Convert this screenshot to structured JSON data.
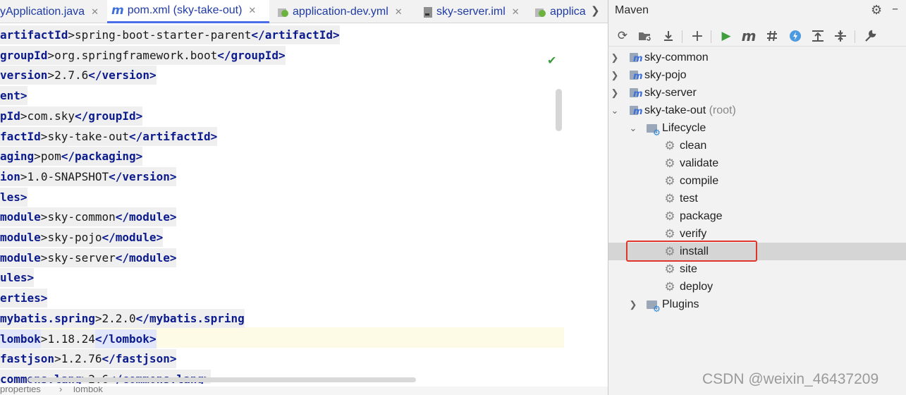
{
  "tabs": [
    {
      "label": "yApplication.java",
      "icon": "java-class-icon",
      "active": false
    },
    {
      "label": "pom.xml (sky-take-out)",
      "icon": "maven-m-icon",
      "active": true
    },
    {
      "label": "application-dev.yml",
      "icon": "spring-config-icon",
      "active": false
    },
    {
      "label": "sky-server.iml",
      "icon": "module-file-icon",
      "active": false
    },
    {
      "label": "applica",
      "icon": "spring-config-icon",
      "active": false
    }
  ],
  "tab_icon_letter": "m",
  "close_glyph": "✕",
  "editor": {
    "lines": [
      {
        "tag": "artifactId",
        "text": "spring-boot-starter-parent",
        "close": "</artifactId>"
      },
      {
        "tag": "groupId",
        "text": "org.springframework.boot",
        "close": "</groupId>"
      },
      {
        "tag": "version",
        "text": "2.7.6",
        "close": "</version>"
      },
      {
        "tag": "ent>",
        "text": "",
        "close": ""
      },
      {
        "tag": "pId",
        "text": "com.sky",
        "close": "</groupId>"
      },
      {
        "tag": "factId",
        "text": "sky-take-out",
        "close": "</artifactId>"
      },
      {
        "tag": "aging",
        "text": "pom",
        "close": "</packaging>"
      },
      {
        "tag": "ion",
        "text": "1.0-SNAPSHOT",
        "close": "</version>"
      },
      {
        "tag": "les>",
        "text": "",
        "close": ""
      },
      {
        "tag": "module",
        "text": "sky-common",
        "close": "</module>"
      },
      {
        "tag": "module",
        "text": "sky-pojo",
        "close": "</module>"
      },
      {
        "tag": "module",
        "text": "sky-server",
        "close": "</module>"
      },
      {
        "tag": "ules>",
        "text": "",
        "close": ""
      },
      {
        "tag": "erties>",
        "text": "",
        "close": ""
      },
      {
        "tag": "mybatis.spring",
        "text": "2.2.0",
        "close": "</mybatis.spring"
      },
      {
        "tag": "lombok",
        "text": "1.18.24",
        "close": "</lombok>"
      },
      {
        "tag": "fastjson",
        "text": "1.2.76",
        "close": "</fastjson>"
      },
      {
        "tag": "commons.lang",
        "text": "2.6",
        "close": "</commons.lang>"
      }
    ],
    "highlighted_line": 15,
    "breadcrumb": [
      "properties",
      "lombok"
    ],
    "breadcrumb_sep": "›",
    "status_check": "✔"
  },
  "maven": {
    "title": "Maven",
    "toolbar_icons": [
      "reload-icon",
      "add-folder-icon",
      "download-icon",
      "add-icon",
      "run-icon",
      "maven-goal-icon",
      "toggle-offline-icon",
      "skip-tests-icon",
      "show-dependencies-icon",
      "collapse-icon",
      "settings-wrench-icon"
    ],
    "modules": [
      {
        "label": "sky-common",
        "suffix": ""
      },
      {
        "label": "sky-pojo",
        "suffix": ""
      },
      {
        "label": "sky-server",
        "suffix": ""
      },
      {
        "label": "sky-take-out",
        "suffix": "(root)"
      }
    ],
    "lifecycle_label": "Lifecycle",
    "lifecycle": [
      "clean",
      "validate",
      "compile",
      "test",
      "package",
      "verify",
      "install",
      "site",
      "deploy"
    ],
    "selected_phase": "install",
    "plugins_label": "Plugins"
  },
  "watermark": "CSDN @weixin_46437209",
  "colors": {
    "tag": "#0b1a8c",
    "tab_text": "#1f3aa5",
    "highlight_box": "#e0352b",
    "selection": "#d5d5d5"
  }
}
